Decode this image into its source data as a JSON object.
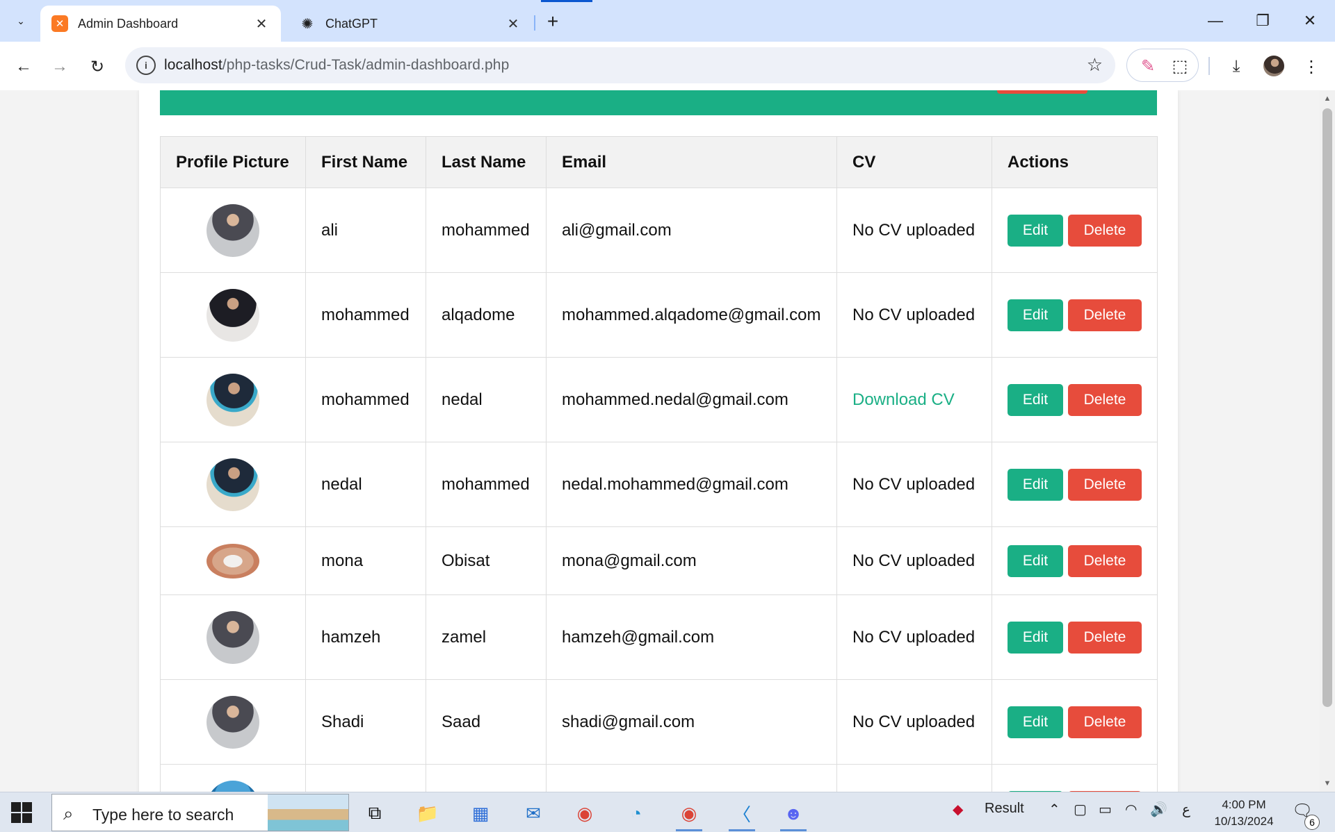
{
  "browser": {
    "tabs": [
      {
        "title": "Admin Dashboard",
        "icon": "xampp-icon",
        "active": true
      },
      {
        "title": "ChatGPT",
        "icon": "chatgpt-icon",
        "active": false
      }
    ],
    "new_tab_label": "+",
    "close_glyph": "✕",
    "url_host": "localhost",
    "url_path": "/php-tasks/Crud-Task/admin-dashboard.php"
  },
  "table": {
    "headers": [
      "Profile Picture",
      "First Name",
      "Last Name",
      "Email",
      "CV",
      "Actions"
    ],
    "edit_label": "Edit",
    "delete_label": "Delete",
    "rows": [
      {
        "first": "ali",
        "last": "mohammed",
        "email": "ali@gmail.com",
        "cv": "No CV uploaded",
        "cv_link": false
      },
      {
        "first": "mohammed",
        "last": "alqadome",
        "email": "mohammed.alqadome@gmail.com",
        "cv": "No CV uploaded",
        "cv_link": false
      },
      {
        "first": "mohammed",
        "last": "nedal",
        "email": "mohammed.nedal@gmail.com",
        "cv": "Download CV",
        "cv_link": true
      },
      {
        "first": "nedal",
        "last": "mohammed",
        "email": "nedal.mohammed@gmail.com",
        "cv": "No CV uploaded",
        "cv_link": false
      },
      {
        "first": "mona",
        "last": "Obisat",
        "email": "mona@gmail.com",
        "cv": "No CV uploaded",
        "cv_link": false
      },
      {
        "first": "hamzeh",
        "last": "zamel",
        "email": "hamzeh@gmail.com",
        "cv": "No CV uploaded",
        "cv_link": false
      },
      {
        "first": "Shadi",
        "last": "Saad",
        "email": "shadi@gmail.com",
        "cv": "No CV uploaded",
        "cv_link": false
      }
    ]
  },
  "colors": {
    "accent_green": "#1aaf85",
    "danger_red": "#e74c3c",
    "tab_strip": "#d3e3fd"
  },
  "taskbar": {
    "search_placeholder": "Type here to search",
    "tray_result": "Result",
    "tray_lang": "ع",
    "time": "4:00 PM",
    "date": "10/13/2024",
    "notification_count": "6"
  }
}
